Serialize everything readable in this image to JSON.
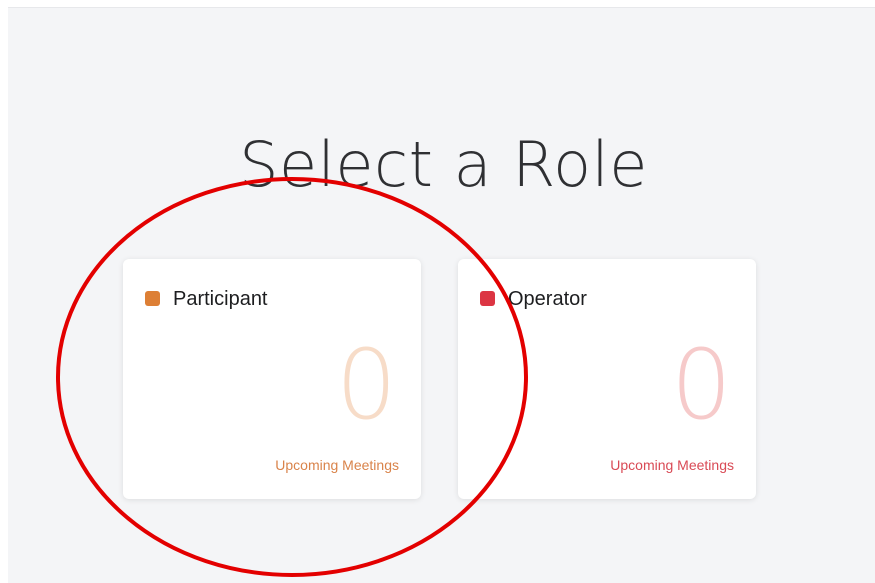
{
  "heading": "Select a Role",
  "roles": [
    {
      "name": "Participant",
      "count": "0",
      "subtitle": "Upcoming Meetings",
      "colors": {
        "accent": "#dd7f35",
        "count": "#f7dcc8",
        "subtitle": "#d9834a"
      }
    },
    {
      "name": "Operator",
      "count": "0",
      "subtitle": "Upcoming Meetings",
      "colors": {
        "accent": "#dc3543",
        "count": "#f6caca",
        "subtitle": "#d94a55"
      }
    }
  ],
  "annotation": {
    "shape": "ellipse",
    "color": "#e30000"
  }
}
